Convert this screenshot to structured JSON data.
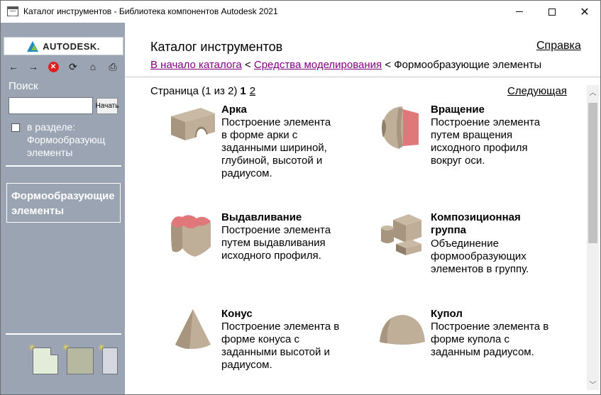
{
  "window": {
    "title": "Каталог инструментов - Библиотека компонентов Autodesk 2021",
    "minimize": "—",
    "maximize": "□",
    "close": "✕"
  },
  "sidebar": {
    "logo_text": "AUTODESK.",
    "toolbar": {
      "back": "←",
      "forward": "→",
      "stop": "✕",
      "refresh": "⟳",
      "home": "⌂",
      "print": "⎙"
    },
    "search_label": "Поиск",
    "search_value": "",
    "search_button": "Начать",
    "in_section_label_line1": "в разделе:",
    "in_section_label_line2": "Формообразующ",
    "in_section_label_line3": "элементы",
    "section_box_line1": "Формообразующие",
    "section_box_line2": "элементы",
    "sparkle": "✳"
  },
  "content": {
    "title": "Каталог инструментов",
    "help": "Справка",
    "breadcrumbs": {
      "home": "В начало каталога",
      "sep1": "<",
      "modeling": "Средства моделирования",
      "sep2": "<",
      "current": "Формообразующие элементы"
    },
    "pager": {
      "label": "Страница (1 из 2)",
      "current": "1",
      "page2": "2",
      "next": "Следующая"
    },
    "items": [
      {
        "name": "Арка",
        "desc_lines": [
          "Построение элемента",
          "в форме арки с",
          "заданными шириной,",
          "глубиной, высотой и",
          "радиусом."
        ]
      },
      {
        "name": "Вращение",
        "desc_lines": [
          "Построение элемента",
          "путем вращения",
          "исходного профиля",
          "вокруг оси."
        ]
      },
      {
        "name": "Выдавливание",
        "desc_lines": [
          "Построение элемента",
          "путем выдавливания",
          "исходного профиля."
        ]
      },
      {
        "name_line1": "Композиционная",
        "name_line2": "группа",
        "desc_lines": [
          "Объединение",
          "формообразующих",
          "элементов в группу."
        ]
      },
      {
        "name": "Конус",
        "desc_lines": [
          "Построение элемента в",
          "форме конуса с",
          "заданными высотой и",
          "радиусом."
        ]
      },
      {
        "name": "Купол",
        "desc_lines": [
          "Построение элемента в",
          "форме купола с",
          "заданным радиусом."
        ]
      }
    ],
    "scroll_up": "︿",
    "scroll_down": "﹀"
  },
  "colors": {
    "sidebar_bg": "#9aa4b3",
    "link_visited": "#800080",
    "shape_tan": "#bfae98",
    "shape_pink": "#e0777a"
  }
}
